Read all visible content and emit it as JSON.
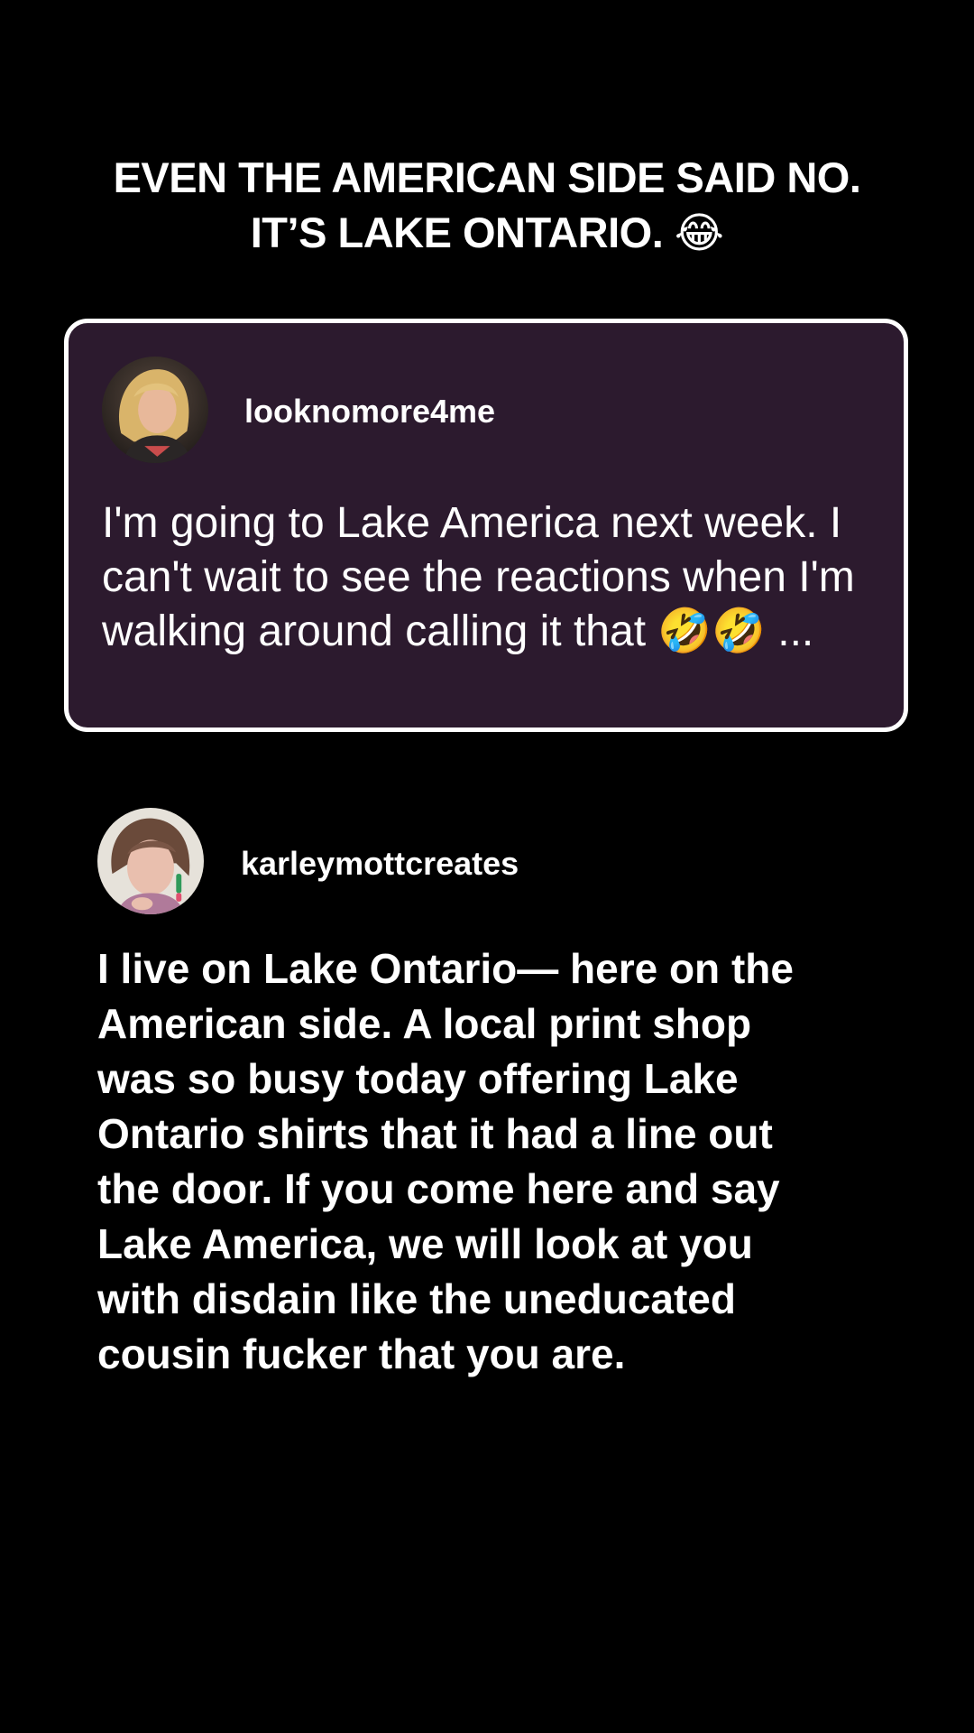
{
  "headline": {
    "line1": "EVEN THE AMERICAN SIDE SAID NO.",
    "line2": "IT’S LAKE ONTARIO. 😂"
  },
  "quoted_comment": {
    "username": "looknomore4me",
    "avatar_icon": "profile-photo-icon",
    "text": "I'm going to Lake America next week. I can't wait to see the reactions when I'm walking around calling it that 🤣🤣 ...",
    "background": "#2c1a2e",
    "border": "#ffffff"
  },
  "reply": {
    "username": "karleymottcreates",
    "avatar_icon": "profile-photo-icon",
    "lines": [
      "I live on Lake Ontario— here on the",
      "American side. A local print shop",
      "was so busy today offering Lake",
      "Ontario shirts that it had a line out",
      "the door. If you come here and say",
      "Lake America, we will look at you",
      "with disdain like the uneducated",
      "cousin fucker that you are."
    ]
  }
}
